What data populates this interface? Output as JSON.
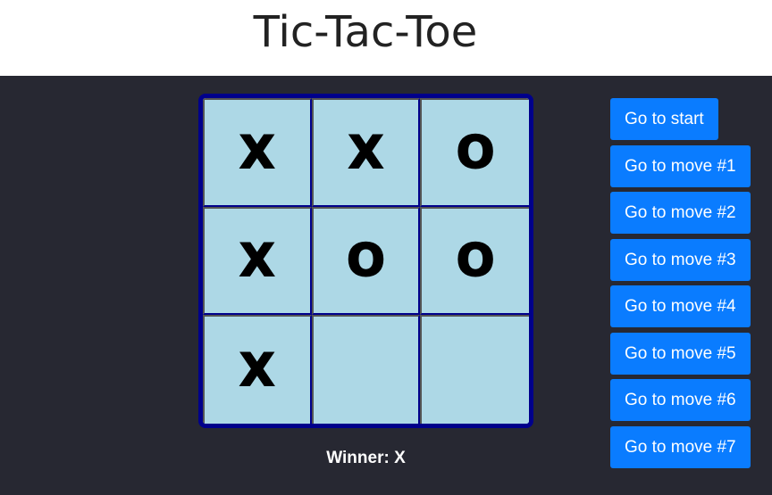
{
  "header": {
    "title": "Tic-Tac-Toe"
  },
  "board": {
    "squares": [
      "X",
      "X",
      "O",
      "X",
      "O",
      "O",
      "X",
      "",
      ""
    ]
  },
  "status": {
    "text": "Winner: X"
  },
  "moves": [
    "Go to start",
    "Go to move #1",
    "Go to move #2",
    "Go to move #3",
    "Go to move #4",
    "Go to move #5",
    "Go to move #6",
    "Go to move #7"
  ],
  "colors": {
    "background": "#272832",
    "header_bg": "#ffffff",
    "board_border": "#00008b",
    "square_bg": "#add8e6",
    "button_bg": "#0a7cff",
    "button_text": "#ffffff"
  }
}
